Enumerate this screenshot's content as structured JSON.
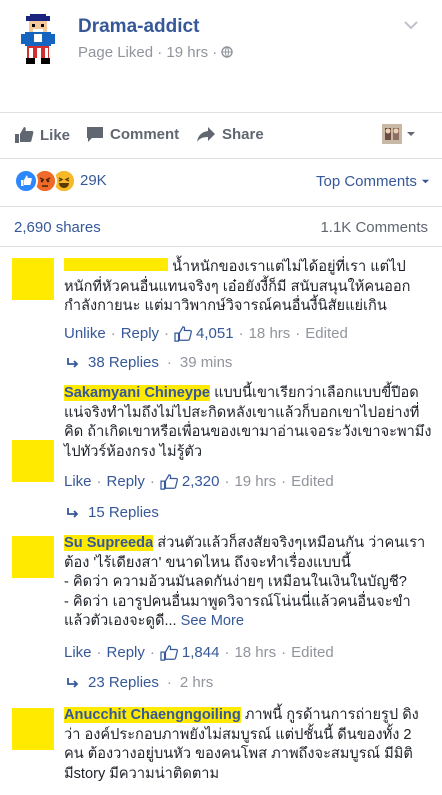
{
  "post": {
    "page_name": "Drama-addict",
    "subline": "Page Liked · 19 hrs ·",
    "actions": {
      "like": "Like",
      "comment": "Comment",
      "share": "Share"
    },
    "reaction_count": "29K",
    "top_comments": "Top Comments",
    "shares": "2,690 shares",
    "comments_count": "1.1K Comments"
  },
  "comments": [
    {
      "name": "",
      "text": "น้ำหนักของเราแต่ไม่ได้อยู่ที่เรา แต่ไปหนักที่หัวคนอื่นแทนจริงๆ เอ๋อยังงี้ก็มี สนับสนุนให้คนออกกำลังกายนะ แต่มาวิพากษ์วิจารณ์คนอื่นงี้นิสัยแย่เกิน",
      "primary_action": "Unlike",
      "reply": "Reply",
      "likes": "4,051",
      "time": "18 hrs",
      "edited": "Edited",
      "replies": "38 Replies",
      "replies_time": "39 mins"
    },
    {
      "name": "Sakamyani Chineype",
      "text": "แบบนี้เขาเรียกว่าเลือกแบบขี้ปีอด แน่จริงทำไมถึงไม่ไปสะกิดหลังเขาแล้วก็บอกเขาไปอย่างที่คิด ถ้าเกิดเขาหรือเพื่อนของเขามาอ่านเจอระวังเขาจะพามึงไปทัวร์ห้องกรง ไม่รู้ตัว",
      "primary_action": "Like",
      "reply": "Reply",
      "likes": "2,320",
      "time": "19 hrs",
      "edited": "Edited",
      "replies": "15 Replies",
      "replies_time": ""
    },
    {
      "name": "Su Supreeda",
      "text_lines": [
        "ส่วนตัวแล้วก็สงสัยจริงๆเหมือนกัน ว่าคนเราต้อง 'ไร้เดียงสา' ขนาดไหน ถึงจะทำเรื่องแบบนี้",
        "- คิดว่า ความอ้วนมันลดกันง่ายๆ เหมือนในเงินในบัญชี?",
        "- คิดว่า เอารูปคนอื่นมาพูดวิจารณ์โน่นนี่แล้วคนอื่นจะขำแล้วตัวเองจะดูดี..."
      ],
      "see_more": "See More",
      "primary_action": "Like",
      "reply": "Reply",
      "likes": "1,844",
      "time": "18 hrs",
      "edited": "Edited",
      "replies": "23 Replies",
      "replies_time": "2 hrs"
    },
    {
      "name": "Anucchit Chaengngoiling",
      "text": "ภาพนี้ กูรด้านการถ่ายรูป ดิงว่า องค์ประกอบภาพยังไม่สมบูรณ์ แต่ปชั้นนี้ ดีนของทั้ง 2 คน ต้องวางอยู่บนหัว ของคนโพส ภาพถึงจะสมบูรณ์ มีมิติ มีstory มีความน่าติดตาม"
    }
  ],
  "colors": {
    "link": "#365899",
    "meta": "#90949c",
    "redaction": "#ffea00"
  }
}
